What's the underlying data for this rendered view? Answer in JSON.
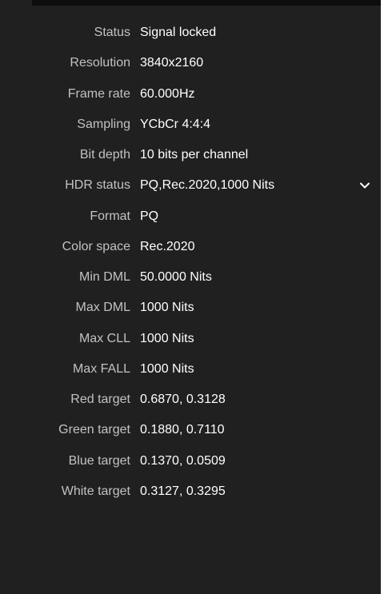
{
  "rows": [
    {
      "label": "Status",
      "value": "Signal locked"
    },
    {
      "label": "Resolution",
      "value": "3840x2160"
    },
    {
      "label": "Frame rate",
      "value": "60.000Hz"
    },
    {
      "label": "Sampling",
      "value": "YCbCr 4:4:4"
    },
    {
      "label": "Bit depth",
      "value": "10 bits per channel"
    },
    {
      "label": "HDR status",
      "value": "PQ,Rec.2020,1000 Nits"
    },
    {
      "label": "Format",
      "value": "PQ"
    },
    {
      "label": "Color space",
      "value": "Rec.2020"
    },
    {
      "label": "Min DML",
      "value": "50.0000 Nits"
    },
    {
      "label": "Max DML",
      "value": "1000 Nits"
    },
    {
      "label": "Max CLL",
      "value": "1000 Nits"
    },
    {
      "label": "Max FALL",
      "value": "1000 Nits"
    },
    {
      "label": "Red target",
      "value": "0.6870, 0.3128"
    },
    {
      "label": "Green target",
      "value": "0.1880, 0.7110"
    },
    {
      "label": "Blue target",
      "value": "0.1370, 0.0509"
    },
    {
      "label": "White target",
      "value": "0.3127, 0.3295"
    }
  ],
  "hdr_status_dropdown": {
    "icon": "chevron-down-icon"
  },
  "colors": {
    "panel_background": "#202020",
    "label_text": "#c2c2c2",
    "value_text": "#ffffff"
  }
}
